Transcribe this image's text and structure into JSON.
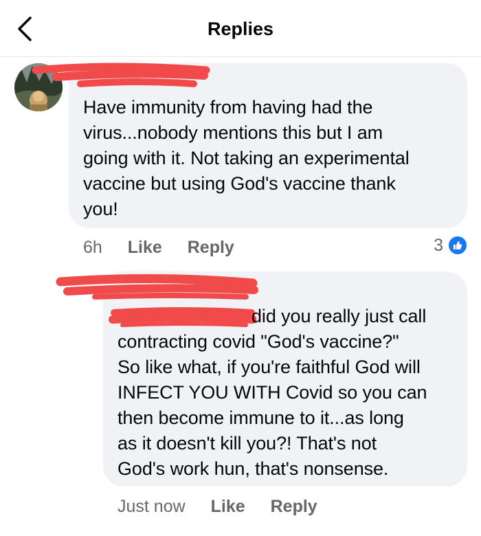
{
  "header": {
    "title": "Replies"
  },
  "comments": [
    {
      "text": "Have immunity from having had the\nvirus...nobody mentions this but I am\ngoing with it. Not taking an experimental\nvaccine but using God's vaccine thank\nyou!",
      "time": "6h",
      "like_label": "Like",
      "reply_label": "Reply",
      "reaction_count": "3"
    },
    {
      "text_first": "did you really just call",
      "text_rest": "contracting covid \"God's vaccine?\"\nSo like what, if you're faithful God will\nINFECT YOU WITH Covid so you can\nthen become immune to it...as long\nas it doesn't kill you?!  That's not\nGod's work hun, that's nonsense.",
      "time": "Just now",
      "like_label": "Like",
      "reply_label": "Reply"
    }
  ],
  "colors": {
    "bubble": "#f0f2f5",
    "meta_text": "#65676b",
    "like_blue": "#1877f2",
    "redaction": "#f04a4a"
  },
  "icons": {
    "back": "chevron-left-icon",
    "like_reaction": "thumbs-up-icon"
  }
}
